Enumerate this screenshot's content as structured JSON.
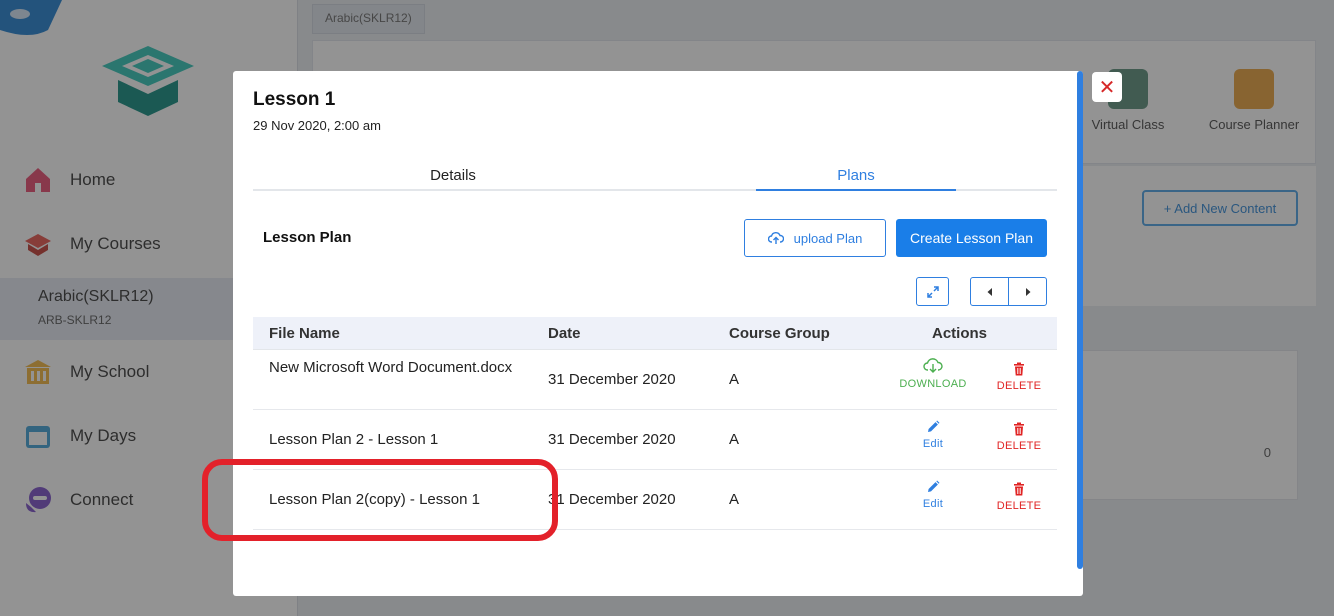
{
  "sidebar": {
    "items": [
      {
        "label": "Home",
        "icon": "home-icon",
        "color": "#e8486e"
      },
      {
        "label": "My Courses",
        "icon": "courses-icon",
        "color": "#e6534a"
      },
      {
        "label": "My School",
        "icon": "school-icon",
        "color": "#f3b53d"
      },
      {
        "label": "My Days",
        "icon": "calendar-icon",
        "color": "#3ea0d6"
      },
      {
        "label": "Connect",
        "icon": "connect-icon",
        "color": "#7a4fc9"
      }
    ],
    "active_course": {
      "title": "Arabic(SKLR12)",
      "code": "ARB-SKLR12"
    }
  },
  "main": {
    "tab_label": "Arabic(SKLR12)",
    "tools": [
      {
        "label": "Virtual Class",
        "icon": "virtual-class-icon"
      },
      {
        "label": "Course Planner",
        "icon": "course-planner-icon"
      }
    ],
    "add_content_label": "+ Add New Content",
    "card_count": "0"
  },
  "modal": {
    "title": "Lesson 1",
    "date": "29 Nov 2020, 2:00 am",
    "tabs": [
      {
        "label": "Details",
        "active": false
      },
      {
        "label": "Plans",
        "active": true
      }
    ],
    "section_heading": "Lesson Plan",
    "upload_label": "upload Plan",
    "create_label": "Create Lesson Plan",
    "table": {
      "headers": [
        "File Name",
        "Date",
        "Course Group",
        "Actions"
      ],
      "rows": [
        {
          "file_name": "New Microsoft Word Document.docx",
          "date": "31 December 2020",
          "group": "A",
          "action1": "DOWNLOAD",
          "action2": "DELETE"
        },
        {
          "file_name": "Lesson Plan 2 - Lesson 1",
          "date": "31 December 2020",
          "group": "A",
          "action1": "Edit",
          "action2": "DELETE"
        },
        {
          "file_name": "Lesson Plan 2(copy) - Lesson 1",
          "date": "31 December 2020",
          "group": "A",
          "action1": "Edit",
          "action2": "DELETE"
        }
      ]
    }
  },
  "colors": {
    "accent": "#1a7ee8",
    "delete": "#e02424",
    "download": "#4caf50",
    "highlight": "#e3212a"
  }
}
